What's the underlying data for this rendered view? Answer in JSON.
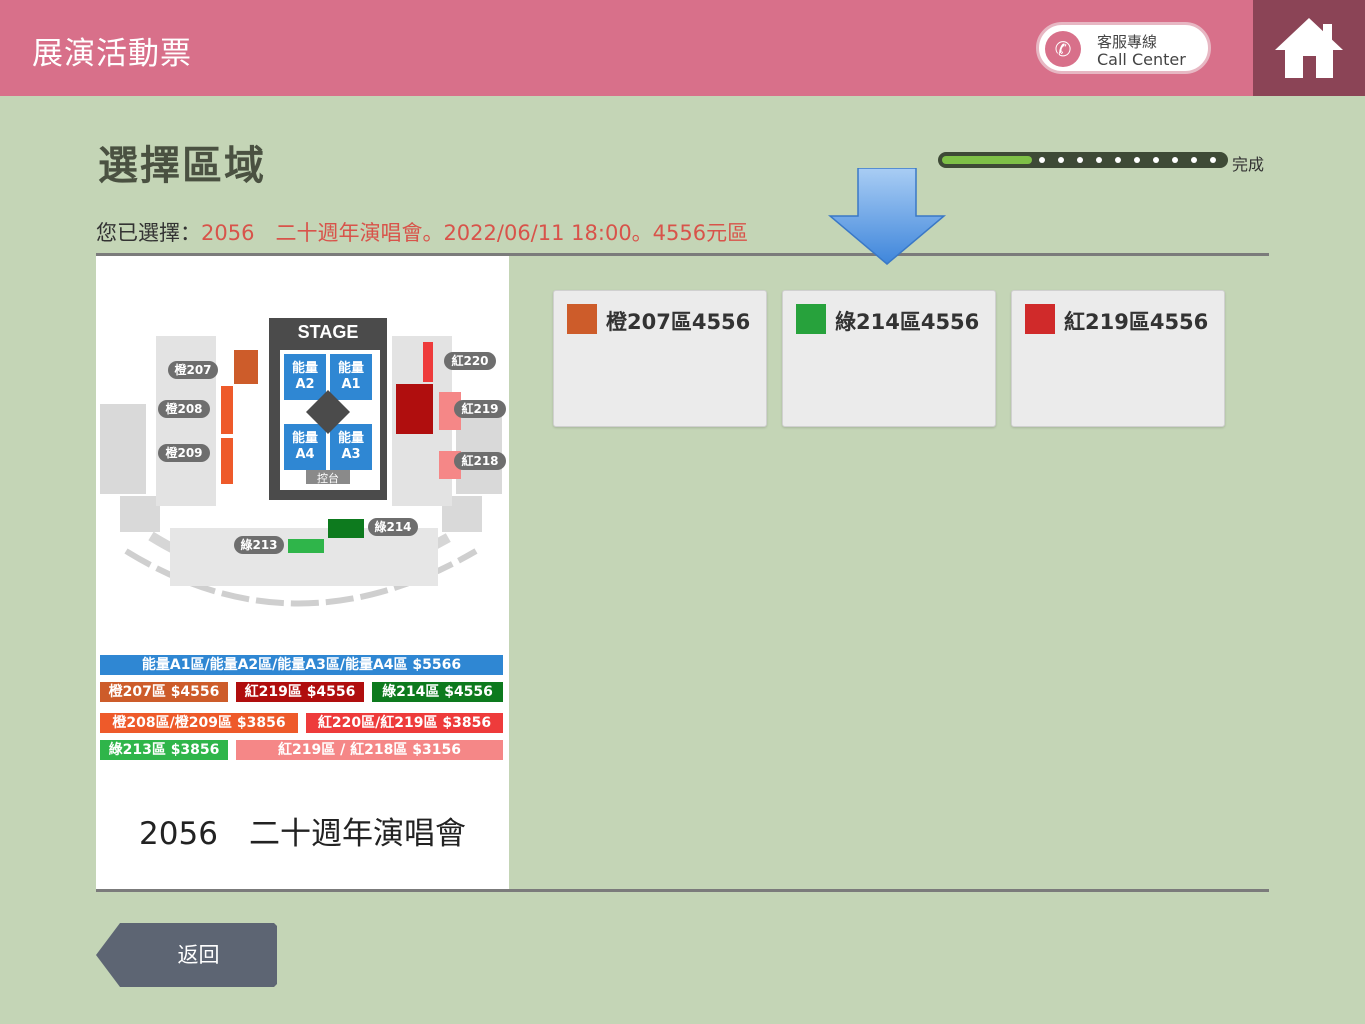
{
  "header": {
    "title": "展演活動票",
    "call_center": {
      "line1": "客服專線",
      "line2": "Call Center",
      "icon": "phone-icon"
    },
    "home_icon": "home-icon"
  },
  "page": {
    "title": "選擇區域",
    "progress": {
      "fraction": 0.32,
      "label": "完成"
    },
    "selection_label": "您已選擇：",
    "selection_value": "2056　二十週年演唱會。2022/06/11 18:00。4556元區"
  },
  "seat_map": {
    "stage": "STAGE",
    "control": "控台",
    "blocks": [
      {
        "line1": "能量",
        "line2": "A2"
      },
      {
        "line1": "能量",
        "line2": "A1"
      },
      {
        "line1": "能量",
        "line2": "A4"
      },
      {
        "line1": "能量",
        "line2": "A3"
      }
    ],
    "tags": {
      "o207": "橙207",
      "o208": "橙208",
      "o209": "橙209",
      "r220": "紅220",
      "r219": "紅219",
      "r218": "紅218",
      "g214": "綠214",
      "g213": "綠213"
    },
    "legend": [
      "能量A1區/能量A2區/能量A3區/能量A4區 $5566",
      "橙207區 $4556",
      "紅219區 $4556",
      "綠214區 $4556",
      "橙208區/橙209區 $3856",
      "紅220區/紅219區 $3856",
      "綠213區 $3856",
      "紅219區 / 紅218區 $3156"
    ],
    "caption": "2056　二十週年演唱會"
  },
  "areas": [
    {
      "name": "橙207區4556",
      "color": "#cd5c2a"
    },
    {
      "name": "綠214區4556",
      "color": "#27a23c"
    },
    {
      "name": "紅219區4556",
      "color": "#d02a2a"
    }
  ],
  "back_label": "返回",
  "colors": {
    "header": "#d8708a",
    "accent": "#d8534a",
    "background": "#c4d5b6"
  }
}
